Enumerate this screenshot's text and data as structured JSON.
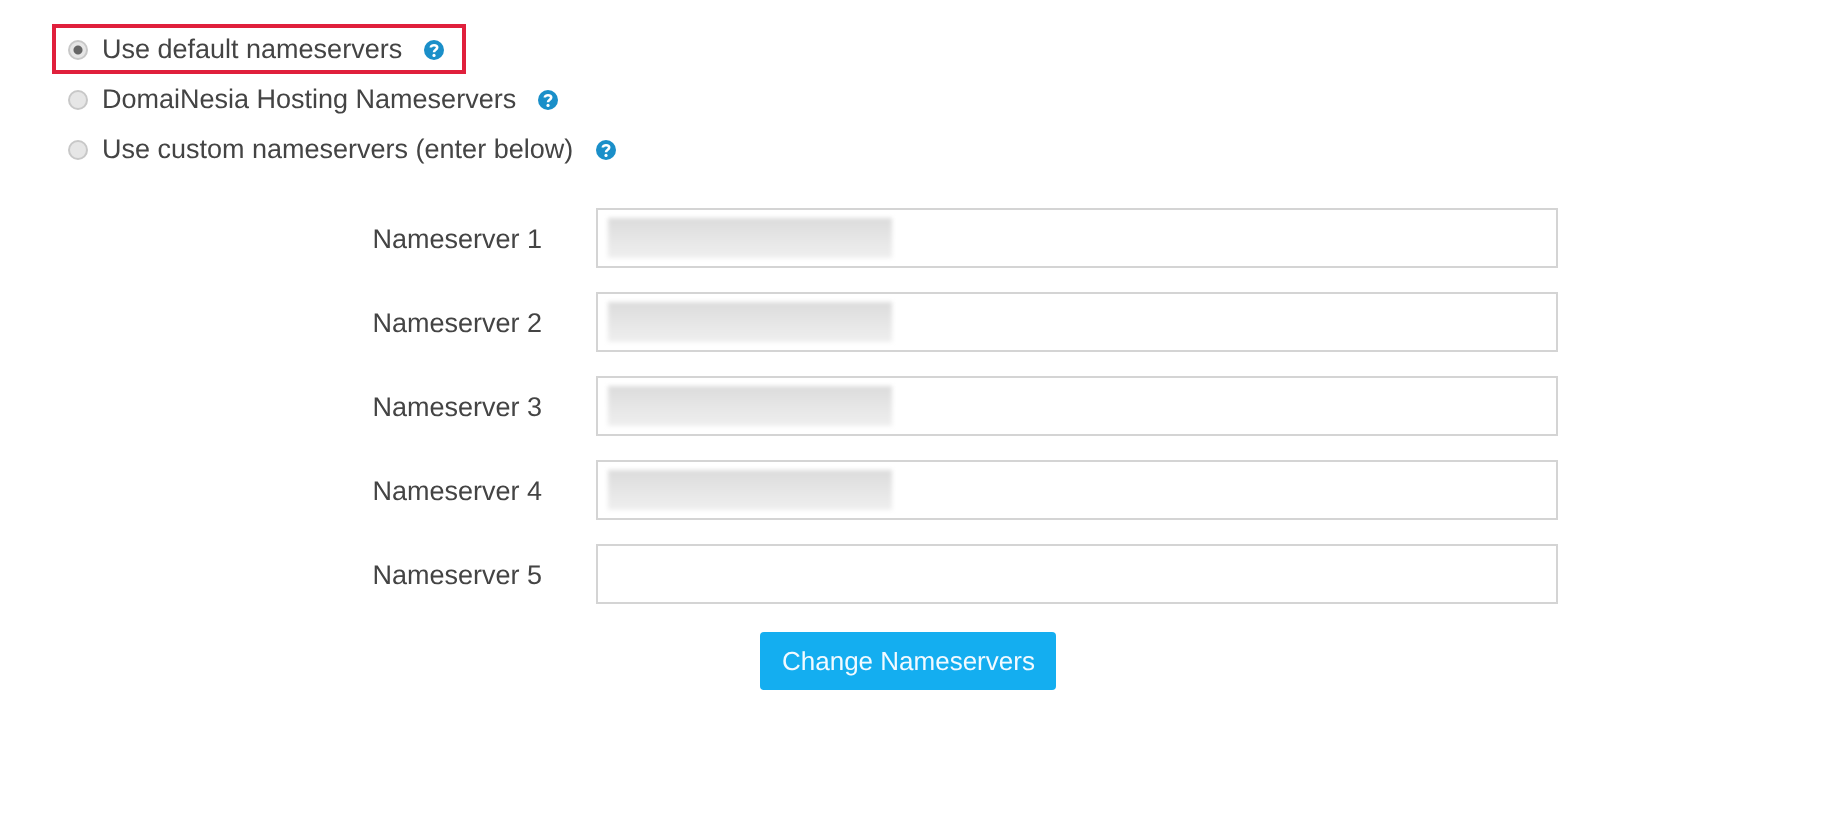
{
  "nameserver_options": [
    {
      "label": "Use default nameservers",
      "selected": true,
      "highlighted": true
    },
    {
      "label": "DomaiNesia Hosting Nameservers",
      "selected": false,
      "highlighted": false
    },
    {
      "label": "Use custom nameservers (enter below)",
      "selected": false,
      "highlighted": false
    }
  ],
  "nameservers": [
    {
      "label": "Nameserver 1",
      "redacted": true
    },
    {
      "label": "Nameserver 2",
      "redacted": true
    },
    {
      "label": "Nameserver 3",
      "redacted": true
    },
    {
      "label": "Nameserver 4",
      "redacted": true
    },
    {
      "label": "Nameserver 5",
      "redacted": false
    }
  ],
  "submit_button": "Change Nameservers"
}
